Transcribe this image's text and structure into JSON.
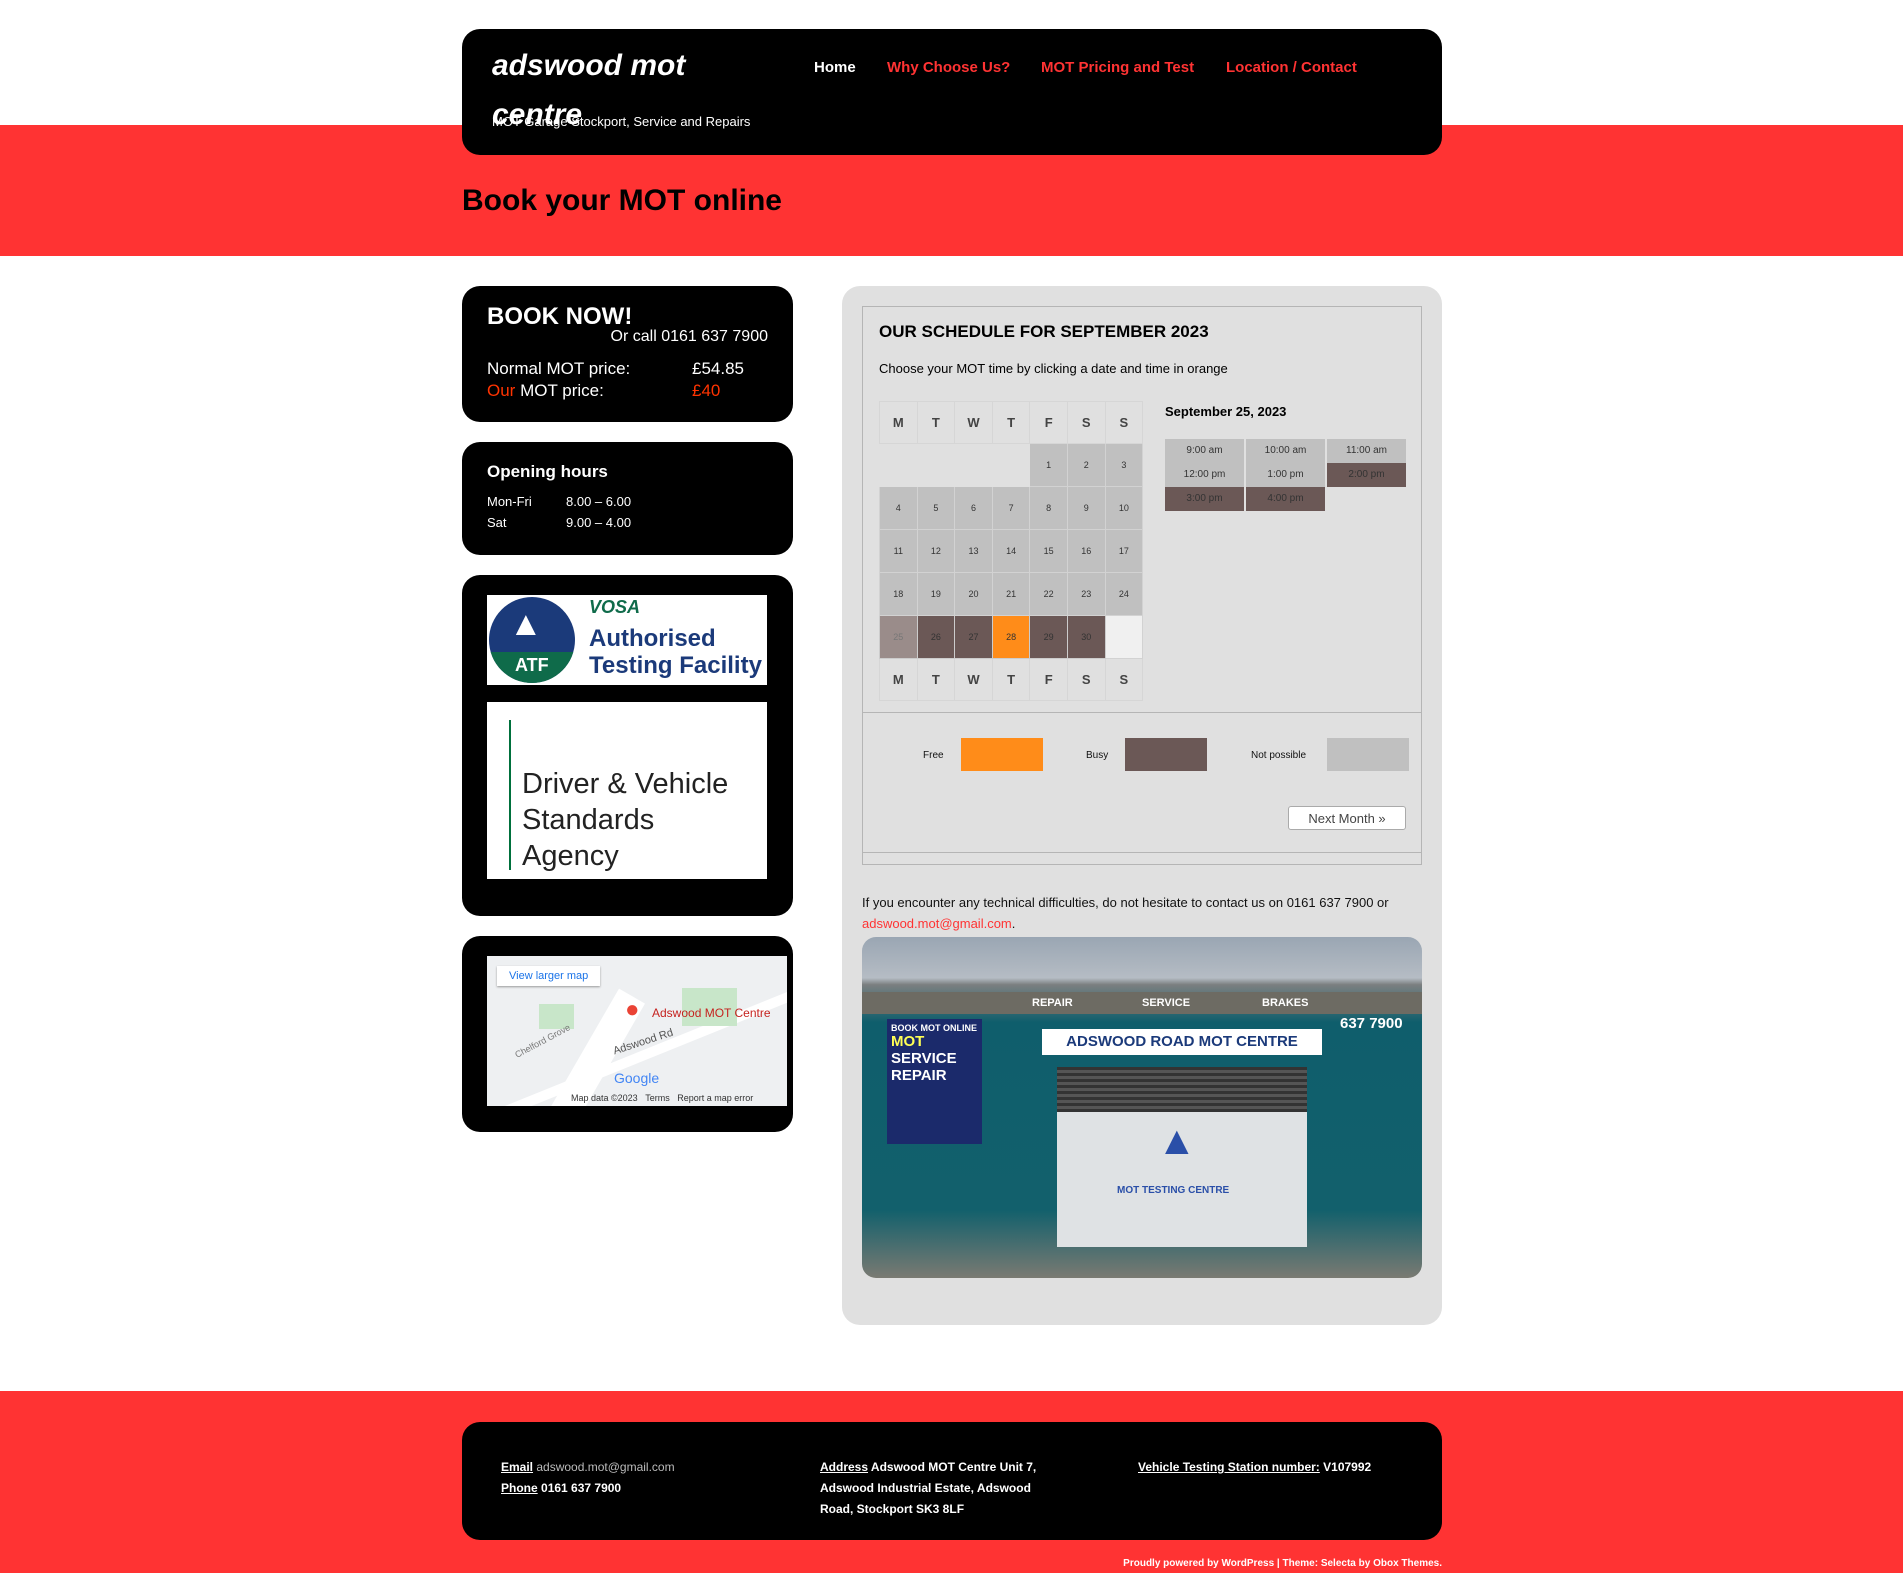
{
  "header": {
    "title": "adswood mot centre",
    "tagline": "MOT Garage Stockport, Service and Repairs",
    "nav": [
      "Home",
      "Why Choose Us?",
      "MOT Pricing and Test",
      "Location / Contact"
    ]
  },
  "page_title": "Book your MOT online",
  "book": {
    "heading": "BOOK NOW!",
    "call": "Or call 0161 637 7900",
    "normal_label": "Normal MOT price:",
    "normal_price": "£54.85",
    "our_word": "Our",
    "our_label": " MOT price:",
    "our_price": "£40"
  },
  "hours": {
    "heading": "Opening hours",
    "rows": [
      {
        "day": "Mon-Fri",
        "time": "8.00 – 6.00"
      },
      {
        "day": "Sat",
        "time": "9.00 – 4.00"
      }
    ]
  },
  "logos": {
    "vosa": "VOSA",
    "atf": "ATF",
    "atf_text1": "Authorised",
    "atf_text2": "Testing Facility",
    "dvsa": "Driver & Vehicle Standards Agency"
  },
  "map": {
    "view_larger": "View larger map",
    "place": "Adswood MOT Centre",
    "road": "Adswood Rd",
    "road2": "Chelford Grove",
    "google": "Google",
    "map_data": "Map data ©2023",
    "terms": "Terms",
    "report": "Report a map error"
  },
  "schedule": {
    "title": "OUR SCHEDULE FOR SEPTEMBER 2023",
    "subtitle": "Choose your MOT time by clicking a date and time in orange",
    "weekdays": [
      "M",
      "T",
      "W",
      "T",
      "F",
      "S",
      "S"
    ],
    "selected_date": "September 25, 2023",
    "days": [
      {
        "d": "1",
        "s": "np"
      },
      {
        "d": "2",
        "s": "np"
      },
      {
        "d": "3",
        "s": "np"
      },
      {
        "d": "4",
        "s": "np"
      },
      {
        "d": "5",
        "s": "np"
      },
      {
        "d": "6",
        "s": "np"
      },
      {
        "d": "7",
        "s": "np"
      },
      {
        "d": "8",
        "s": "np"
      },
      {
        "d": "9",
        "s": "np"
      },
      {
        "d": "10",
        "s": "np"
      },
      {
        "d": "11",
        "s": "np"
      },
      {
        "d": "12",
        "s": "np"
      },
      {
        "d": "13",
        "s": "np"
      },
      {
        "d": "14",
        "s": "np"
      },
      {
        "d": "15",
        "s": "np"
      },
      {
        "d": "16",
        "s": "np"
      },
      {
        "d": "17",
        "s": "np"
      },
      {
        "d": "18",
        "s": "np"
      },
      {
        "d": "19",
        "s": "np"
      },
      {
        "d": "20",
        "s": "np"
      },
      {
        "d": "21",
        "s": "np"
      },
      {
        "d": "22",
        "s": "np"
      },
      {
        "d": "23",
        "s": "np"
      },
      {
        "d": "24",
        "s": "np"
      },
      {
        "d": "25",
        "s": "past"
      },
      {
        "d": "26",
        "s": "busy"
      },
      {
        "d": "27",
        "s": "busy"
      },
      {
        "d": "28",
        "s": "free"
      },
      {
        "d": "29",
        "s": "busy"
      },
      {
        "d": "30",
        "s": "busy"
      }
    ],
    "slots": [
      {
        "t": "9:00 am",
        "s": "np"
      },
      {
        "t": "10:00 am",
        "s": "np"
      },
      {
        "t": "11:00 am",
        "s": "np"
      },
      {
        "t": "12:00 pm",
        "s": "np"
      },
      {
        "t": "1:00 pm",
        "s": "np"
      },
      {
        "t": "2:00 pm",
        "s": "busy"
      },
      {
        "t": "3:00 pm",
        "s": "busy"
      },
      {
        "t": "4:00 pm",
        "s": "busy"
      }
    ],
    "legend": {
      "free": "Free",
      "busy": "Busy",
      "not_possible": "Not possible"
    },
    "next_month": "Next Month »",
    "colors": {
      "free": "#ff8c19",
      "busy": "#6b5856",
      "not_possible": "#c0c0c0"
    }
  },
  "contact": {
    "text": "If you encounter any technical difficulties, do not hesitate to contact us on 0161 637 7900 or ",
    "email": "adswood.mot@gmail.com",
    "end": "."
  },
  "photo": {
    "sign": "ADSWOOD ROAD MOT CENTRE",
    "repair": "REPAIR",
    "service": "SERVICE",
    "brakes": "BRAKES",
    "phone": "637 7900",
    "board1": "BOOK MOT ONLINE",
    "board2": "MOT",
    "board3": "SERVICE",
    "board4": "REPAIR",
    "door": "MOT TESTING CENTRE"
  },
  "footer": {
    "email_label": "Email",
    "email": "adswood.mot@gmail.com",
    "phone_label": "Phone",
    "phone": "0161 637 7900",
    "address_label": "Address",
    "address1": "Adswood MOT Centre Unit 7,",
    "address2": "Adswood Industrial Estate, Adswood",
    "address3": "Road, Stockport SK3 8LF",
    "vts_label": "Vehicle Testing Station number:",
    "vts": "V107992",
    "credit": "Proudly powered by WordPress | Theme: Selecta by Obox Themes."
  }
}
